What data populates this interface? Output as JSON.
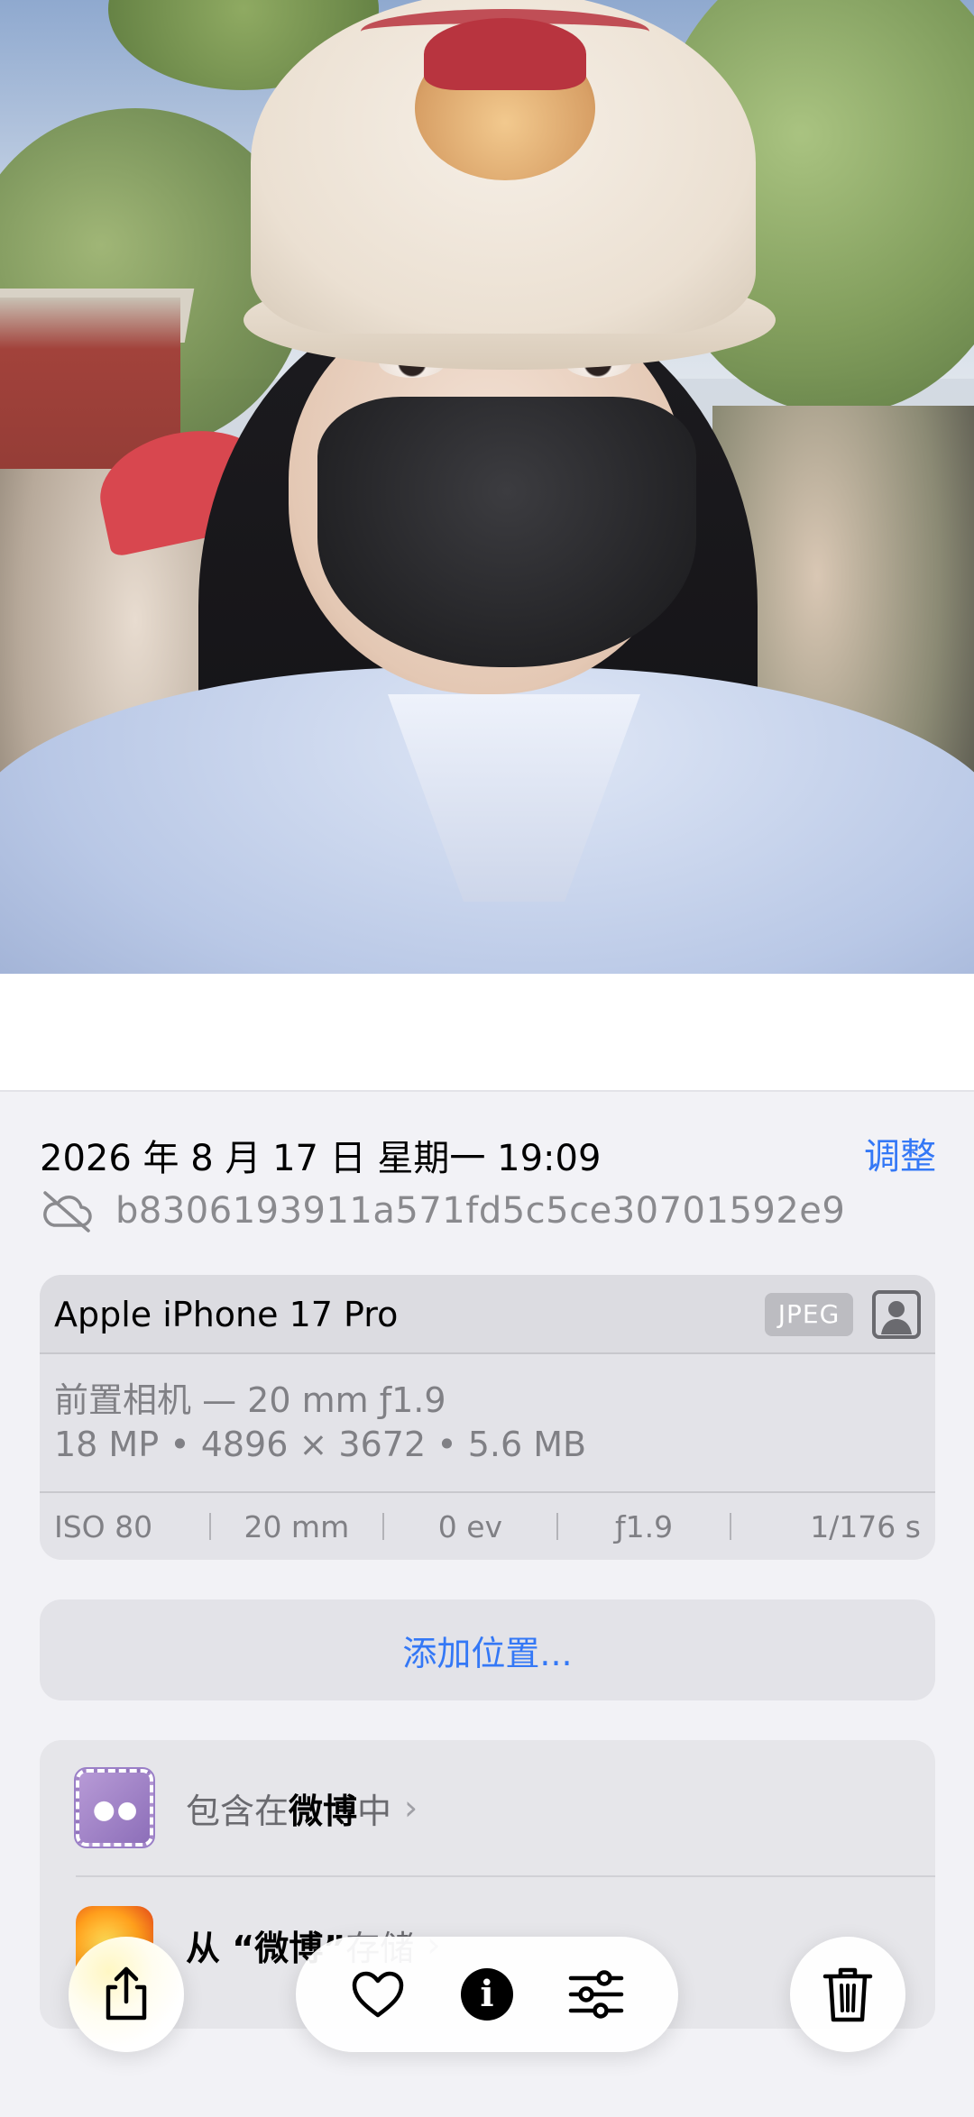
{
  "photo": {
    "subject": "photo"
  },
  "info_panel": {
    "date_time": "2026 年 8 月 17 日 星期一 19:09",
    "adjust_label": "调整",
    "file_name": "b8306193911a571fd5c5ce30701592e9"
  },
  "device": {
    "name": "Apple iPhone 17 Pro",
    "format_badge": "JPEG",
    "lens": "前置相机 — 20 mm ƒ1.9",
    "specs": "18 MP • 4896 × 3672 • 5.6 MB",
    "exif": {
      "iso": "ISO 80",
      "focal": "20 mm",
      "ev": "0 ev",
      "aperture": "ƒ1.9",
      "shutter": "1/176 s"
    }
  },
  "location": {
    "add_label": "添加位置..."
  },
  "albums": {
    "included_prefix": "包含在",
    "included_app": "微博",
    "included_suffix": "中",
    "from_prefix": "从 “微博”",
    "from_suffix": "存储"
  },
  "toolbar": {
    "share_icon": "share-icon",
    "favorite_icon": "heart-icon",
    "info_icon": "info-icon",
    "edit_icon": "sliders-icon",
    "delete_icon": "trash-icon",
    "info_glyph": "i"
  },
  "colors": {
    "accent": "#3478f6",
    "background": "#f2f2f6",
    "card": "#e3e3e8",
    "secondary_text": "#808085"
  }
}
